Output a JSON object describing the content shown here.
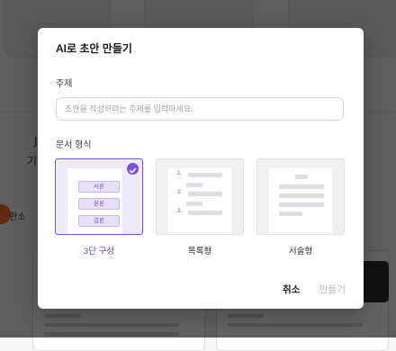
{
  "background": {
    "char_left": "J",
    "char_left2": "기",
    "badge_label": "한소"
  },
  "modal": {
    "title": "AI로 초안 만들기",
    "topic": {
      "label": "주제",
      "placeholder": "초안을 작성하려는 주제를 입력하세요.",
      "value": ""
    },
    "format": {
      "label": "문서 형식",
      "options": [
        {
          "caption": "3단 구성",
          "selected": true,
          "sections": [
            "서론",
            "본론",
            "결론"
          ]
        },
        {
          "caption": "목록형",
          "selected": false,
          "numbers": [
            "1.",
            "2.",
            "3."
          ]
        },
        {
          "caption": "서술형",
          "selected": false
        }
      ]
    },
    "buttons": {
      "cancel": "취소",
      "create": "만들기"
    }
  },
  "colors": {
    "accent": "#7b4fe0",
    "accent_light": "#efe9fc",
    "overlay": "rgba(0,0,0,0.62)",
    "disabled_text": "#b9b9be"
  },
  "icons": {
    "selected_check": "check-icon"
  }
}
